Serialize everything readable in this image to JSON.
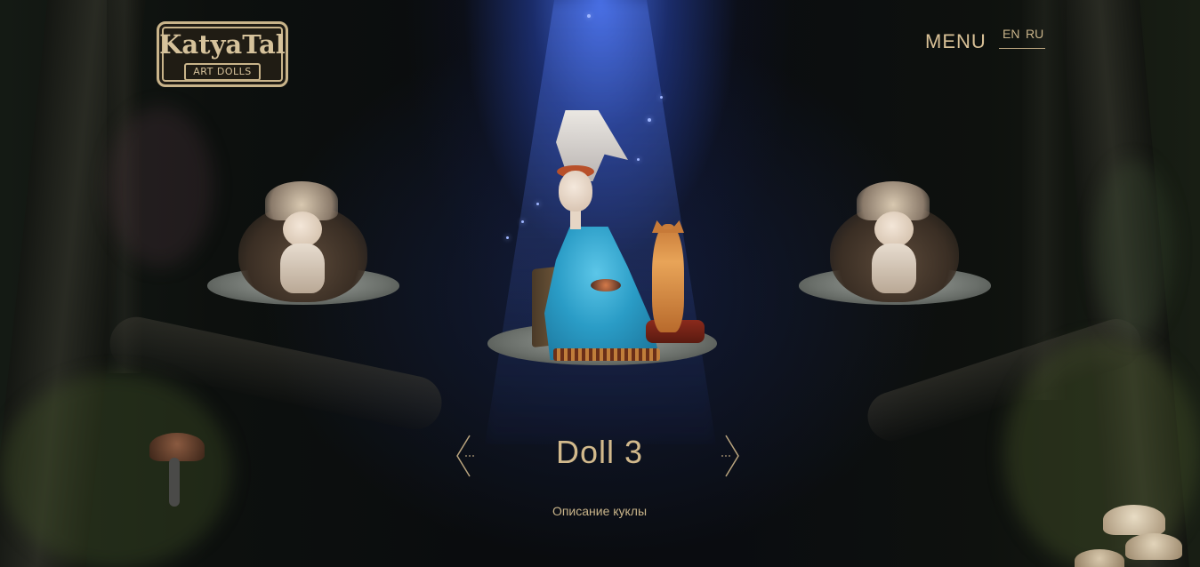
{
  "header": {
    "logo": {
      "main_text": "KatyaTal",
      "sub_text": "ART DOLLS"
    },
    "menu_label": "MENU",
    "languages": [
      "EN",
      "RU"
    ],
    "active_language": "EN"
  },
  "carousel": {
    "current": {
      "title": "Doll 3",
      "description": "Описание куклы"
    },
    "icons": {
      "prev": "chevron-left-icon",
      "next": "chevron-right-icon"
    }
  },
  "colors": {
    "accent_gold": "#d2b98c",
    "spotlight_blue": "#4a6fe0",
    "background": "#0b0d10"
  }
}
